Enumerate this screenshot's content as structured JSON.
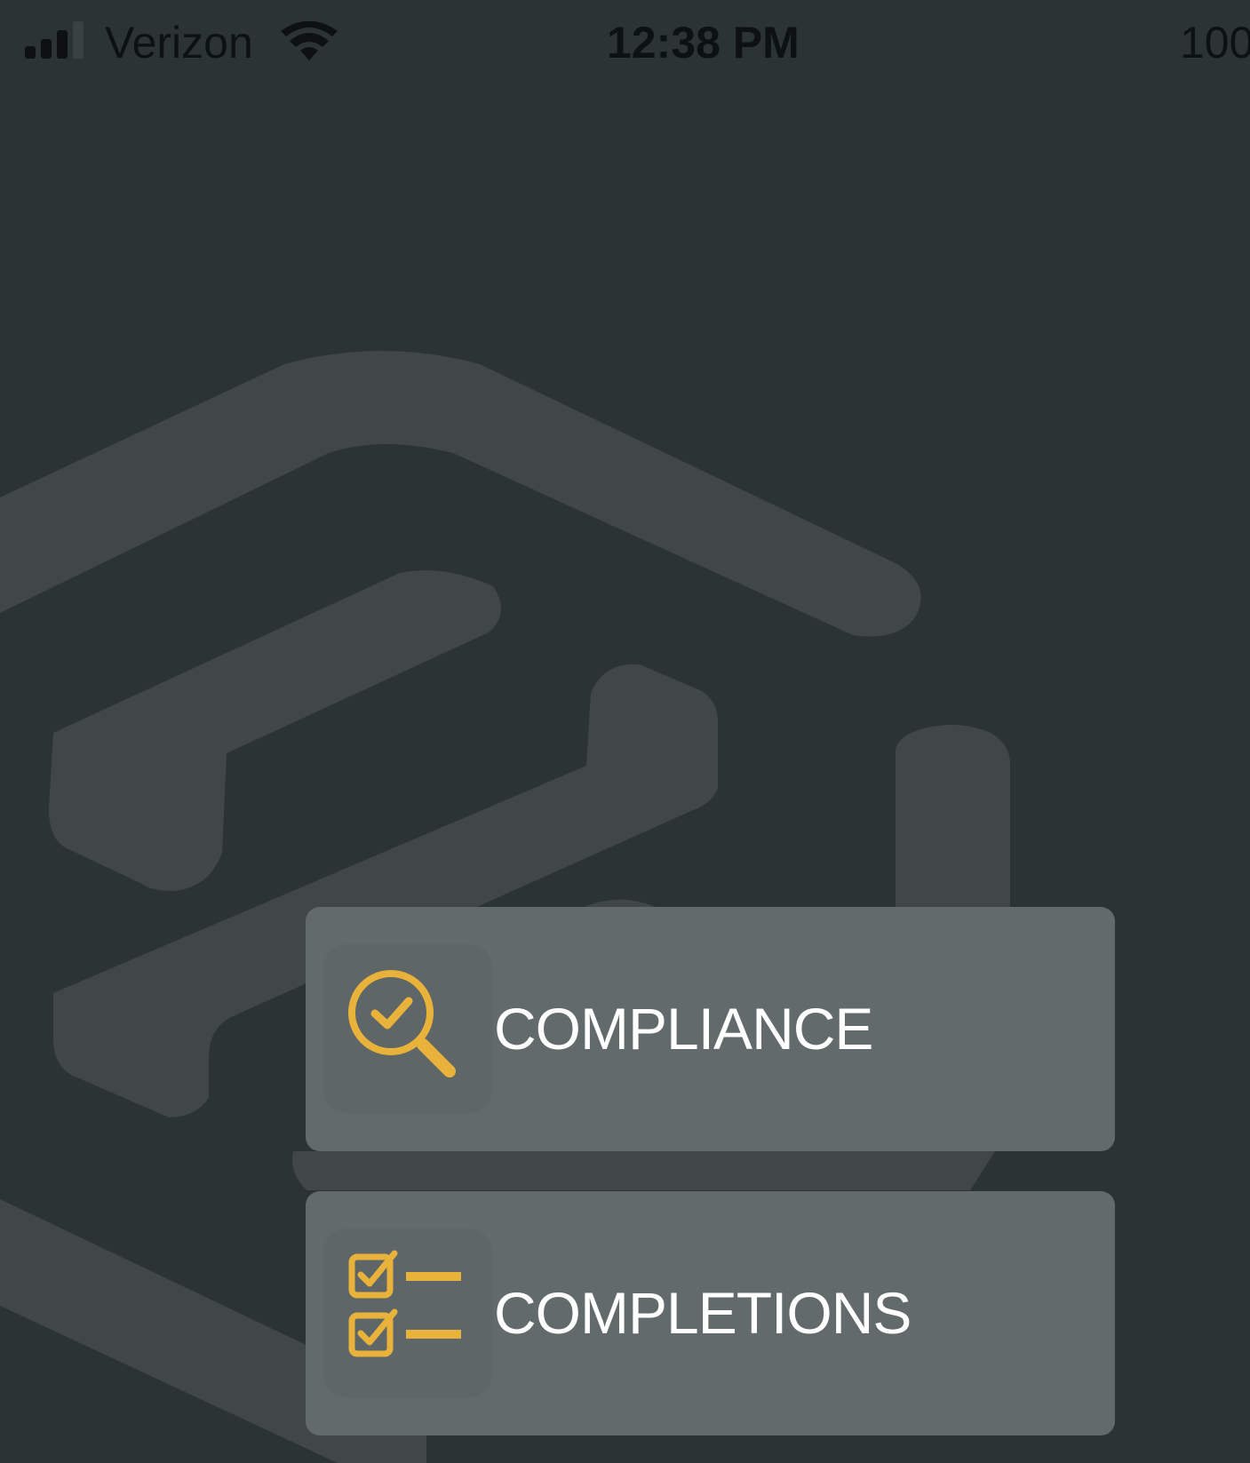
{
  "status_bar": {
    "carrier": "Verizon",
    "time": "12:38 PM",
    "battery": "100",
    "signal_icon": "cellular-signal-icon",
    "wifi_icon": "wifi-icon"
  },
  "background": {
    "logo": "app-logo-watermark"
  },
  "menu": {
    "compliance": {
      "label": "COMPLIANCE",
      "icon": "magnifier-check-icon"
    },
    "completions": {
      "label": "COMPLETIONS",
      "icon": "checklist-icon"
    }
  },
  "colors": {
    "background": "#2c3433",
    "watermark": "#414749",
    "button": "#636a6b",
    "accent": "#e9b23a",
    "status_text": "#0e1112",
    "label_text": "#ffffff"
  }
}
